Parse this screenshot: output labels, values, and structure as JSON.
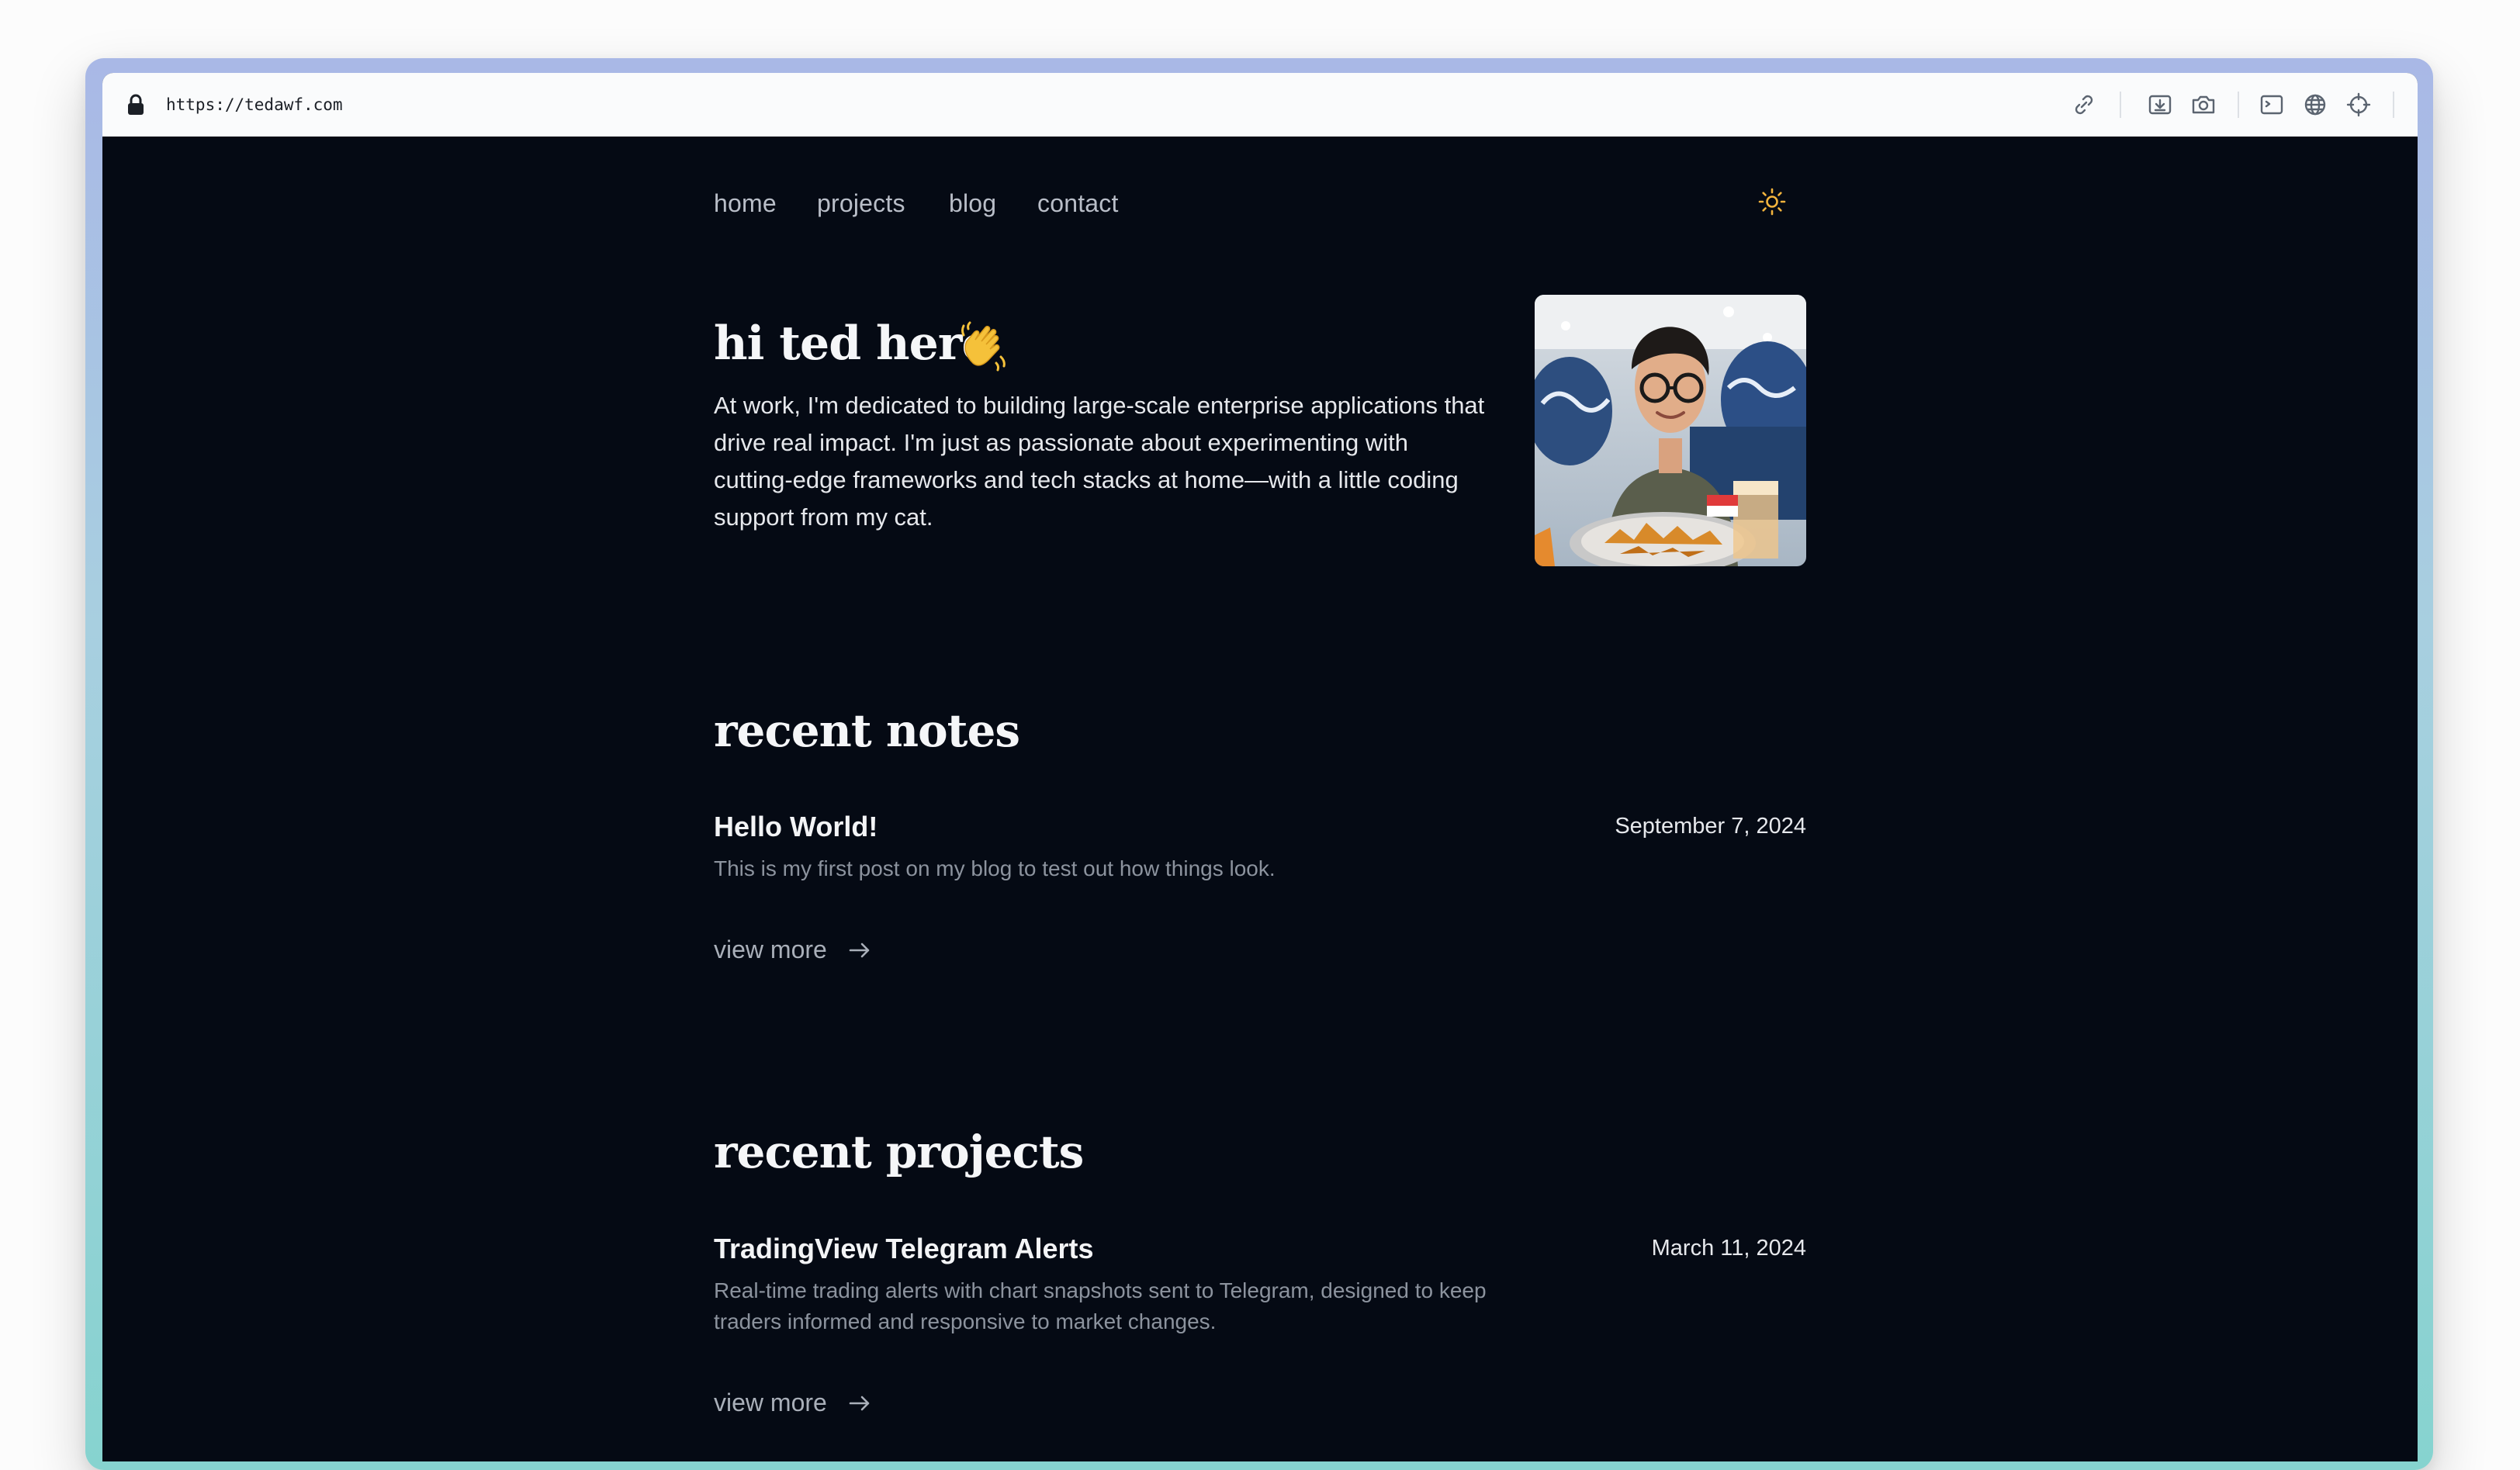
{
  "browser": {
    "url": "https://tedawf.com",
    "icons": [
      "lock-icon",
      "link-icon",
      "download-icon",
      "camera-icon",
      "terminal-icon",
      "globe-icon",
      "crosshair-icon",
      "extension-icon",
      "sidebar-icon"
    ]
  },
  "nav": {
    "items": [
      "home",
      "projects",
      "blog",
      "contact"
    ],
    "theme_icon": "sun-icon"
  },
  "hero": {
    "title": "hi ted here",
    "emoji": "waving-hand-icon",
    "bio": "At work, I'm dedicated to building large-scale enterprise applications that drive real impact. I'm just as passionate about experimenting with cutting-edge frameworks and tech stacks at home—with a little coding support from my cat."
  },
  "notes": {
    "heading": "recent notes",
    "items": [
      {
        "title": "Hello World!",
        "date": "September 7, 2024",
        "summary": "This is my first post on my blog to test out how things look."
      }
    ],
    "view_more": "view more"
  },
  "projects": {
    "heading": "recent projects",
    "items": [
      {
        "title": "TradingView Telegram Alerts",
        "date": "March 11, 2024",
        "summary": "Real-time trading alerts with chart snapshots sent to Telegram, designed to keep traders informed and responsive to market changes."
      }
    ],
    "view_more": "view more"
  },
  "colors": {
    "background": "#050a14",
    "text": "#f5f6f8",
    "muted": "#8c939e",
    "theme_icon": "#f2b33d",
    "frame_gradient": [
      "#a9b8e6",
      "#86d3cf"
    ]
  }
}
